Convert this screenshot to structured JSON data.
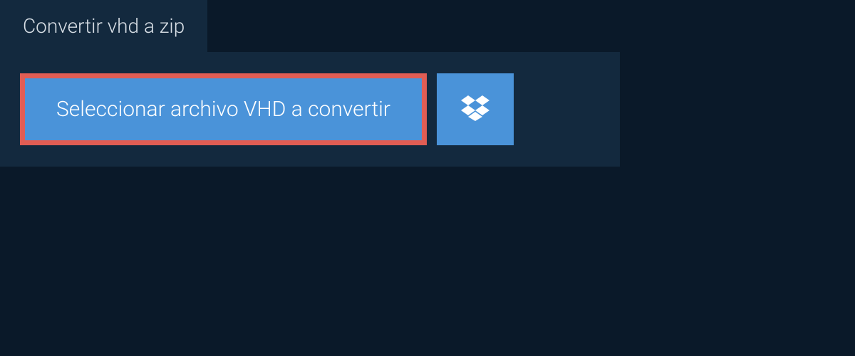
{
  "tab": {
    "title": "Convertir vhd a zip"
  },
  "upload": {
    "select_button_label": "Seleccionar archivo VHD a convertir"
  },
  "colors": {
    "background": "#0a1929",
    "panel": "#13293e",
    "button": "#4a93d9",
    "highlight_border": "#e15d54",
    "text_light": "#ffffff"
  }
}
